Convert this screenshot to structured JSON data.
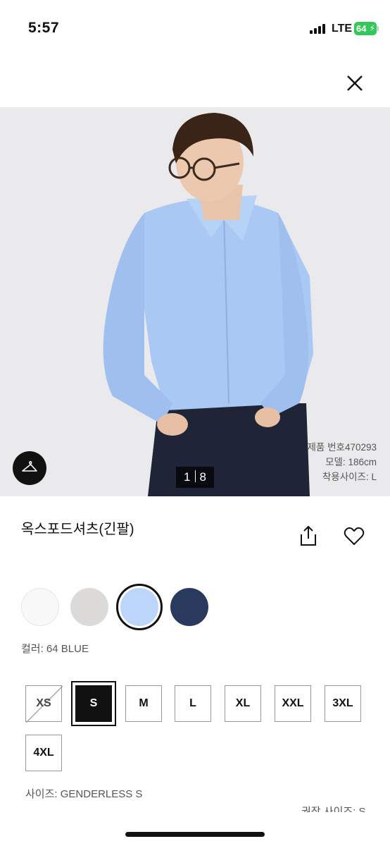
{
  "status_bar": {
    "time": "5:57",
    "network": "LTE",
    "battery": "64"
  },
  "gallery": {
    "pager_current": "1",
    "pager_total": "8",
    "model_info": [
      "제품 번호470293",
      "모델: 186cm",
      "착용사이즈: L"
    ]
  },
  "product": {
    "title": "옥스포드셔츠(긴팔)",
    "colors": [
      {
        "name": "white",
        "hex": "#f8f8f8"
      },
      {
        "name": "light-gray",
        "hex": "#dcdad8"
      },
      {
        "name": "blue",
        "hex": "#bcd5fa",
        "selected": true
      },
      {
        "name": "navy",
        "hex": "#2a3a5e"
      }
    ],
    "color_label": "컬러: 64 BLUE",
    "sizes": [
      {
        "label": "XS",
        "state": "disabled"
      },
      {
        "label": "S",
        "state": "selected"
      },
      {
        "label": "M",
        "state": "available"
      },
      {
        "label": "L",
        "state": "available"
      },
      {
        "label": "XL",
        "state": "available"
      },
      {
        "label": "XXL",
        "state": "available"
      },
      {
        "label": "3XL",
        "state": "available"
      },
      {
        "label": "4XL",
        "state": "available"
      }
    ],
    "size_label": "사이즈: GENDERLESS S",
    "recommended_size_label": "권장 사이즈: S"
  },
  "icons": [
    "close-icon",
    "hanger-icon",
    "share-icon",
    "heart-icon"
  ]
}
